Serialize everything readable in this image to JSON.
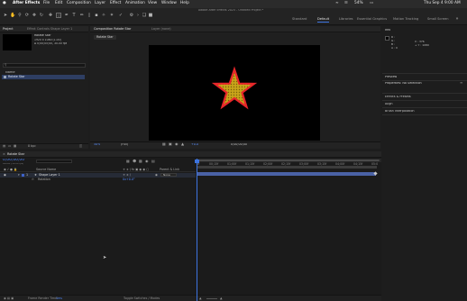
{
  "menubar": {
    "app_name": "After Effects",
    "items": [
      "File",
      "Edit",
      "Composition",
      "Layer",
      "Effect",
      "Animation",
      "View",
      "Window",
      "Help"
    ],
    "battery": "54%",
    "time": "Thu Sep 4 9:00 AM"
  },
  "toolbar": {
    "window_title": "Adobe After Effects 2025 - Untitled Project *",
    "fill_label": "Fill",
    "stroke_label": "Stroke",
    "stroke_width": "10 px",
    "bezier_path_label": "Bezier Path",
    "auto_open_label": "Auto-Open Panel",
    "workspaces": [
      "Standard",
      "Default",
      "Libraries",
      "Essential Graphics",
      "Motion Tracking",
      "Small Screen"
    ]
  },
  "project": {
    "tab_label": "Project",
    "tab2_label": "Effect Controls Shape Layer 1",
    "comp_name": "Rotate Star",
    "comp_info_1": "1920 x 1080 (1.00)",
    "comp_info_2": "Δ 0;00;05;00, 30.00 fps",
    "search_placeholder": "Search",
    "col_name": "Name",
    "item_name": "Rotate Star",
    "bpc": "8 bpc"
  },
  "comp_viewer": {
    "tab_label": "Composition Rotate Star",
    "layer_tab_label": "Layer (none)",
    "comp_button": "Rotate Star",
    "zoom": "50%",
    "resolution": "(Full)",
    "timecode": "0;00;00;00",
    "exposure": "+0.0"
  },
  "info_panel": {
    "info_label": "Info",
    "r": "R :",
    "g": "G :",
    "b": "B :",
    "a": "A : 0",
    "x": "X : 376",
    "y": "+ Y : 1080",
    "preview_label": "Preview",
    "properties_label": "Properties: No Selection",
    "effects_label": "Effects & Presets",
    "align_label": "Align",
    "brainstorm_label": "Brush Interpolation"
  },
  "timeline": {
    "comp_tab": "Rotate Star",
    "current_time": "0;00;00;00",
    "fps_hint": "00000 (30.00 fps)",
    "col_source_name": "Source Name",
    "col_parent": "Parent & Link",
    "layer_number": "1",
    "layer_name": "Shape Layer 1",
    "parent_value": "None",
    "prop_name": "Rotation",
    "prop_value": "0x+0.0°",
    "ruler_ticks": [
      "0f",
      "00;15f",
      "01;00f",
      "01;15f",
      "02;00f",
      "02;15f",
      "03;00f",
      "03;15f",
      "04;00f",
      "04;15f",
      "05:0"
    ],
    "frame_render_label": "Frame Render Time:",
    "frame_render_value": "1ms",
    "toggle_label": "Toggle Switches / Modes"
  },
  "colors": {
    "accent": "#3d74e0",
    "star_fill": "#c8a41a",
    "star_stroke": "#e8262a",
    "layer_bar": "#4a62a6"
  }
}
